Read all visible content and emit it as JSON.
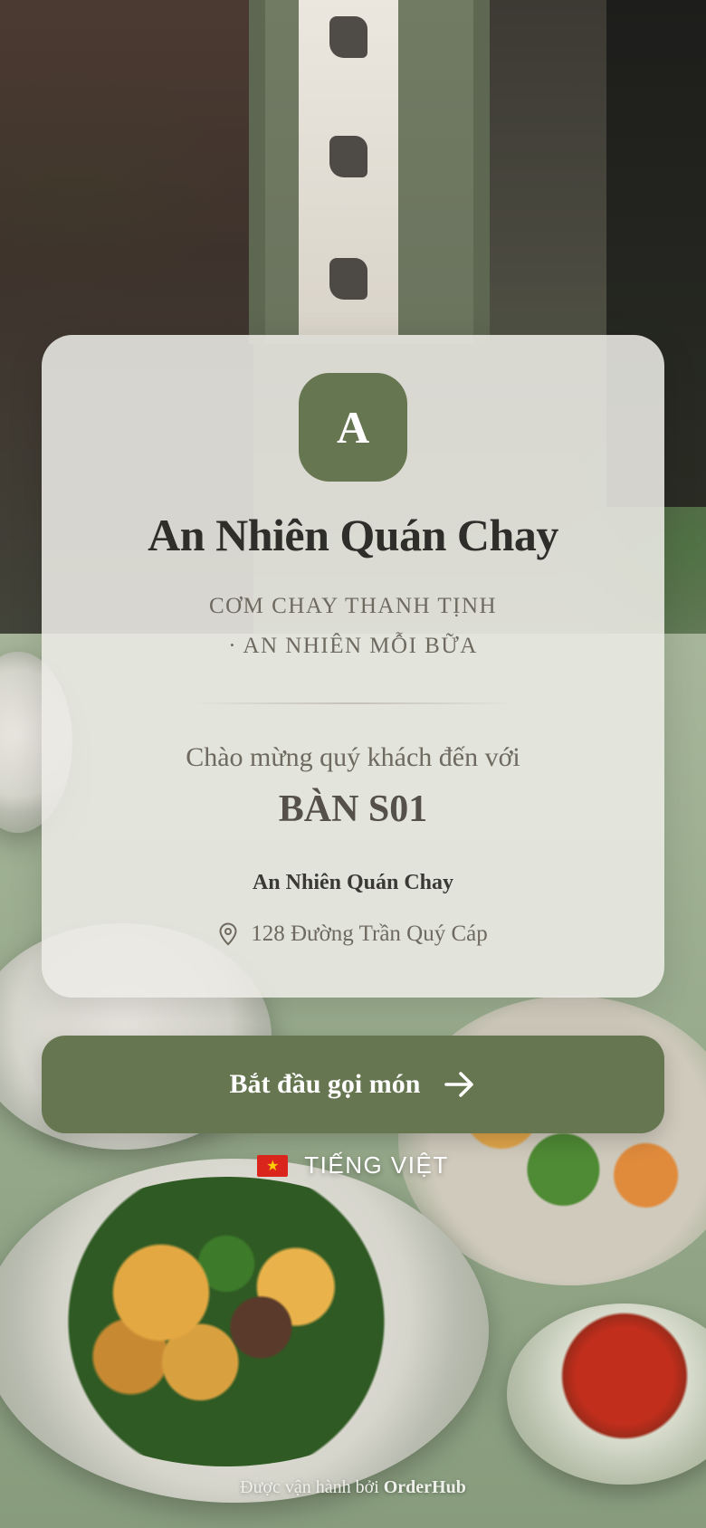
{
  "brand": {
    "logo_letter": "A",
    "name": "An Nhiên Quán Chay",
    "tagline_line1": "CƠM CHAY THANH TỊNH",
    "tagline_line2": "· AN NHIÊN MỖI BỮA"
  },
  "welcome": {
    "text": "Chào mừng quý khách đến với",
    "table": "BÀN S01"
  },
  "branch": {
    "name": "An Nhiên Quán Chay",
    "address": "128 Đường Trần Quý Cáp",
    "address_icon": "location-pin-icon"
  },
  "cta": {
    "label": "Bắt đầu gọi món",
    "icon": "arrow-right-icon"
  },
  "language": {
    "flag_icon": "vietnam-flag-icon",
    "label": "TIẾNG VIỆT"
  },
  "footer": {
    "prefix": "Được vận hành bởi",
    "brand": "OrderHub"
  },
  "colors": {
    "accent": "#667651",
    "card_bg": "#ECEAE5",
    "title_text": "#2F2E2A",
    "muted_text": "#6E6A60"
  }
}
